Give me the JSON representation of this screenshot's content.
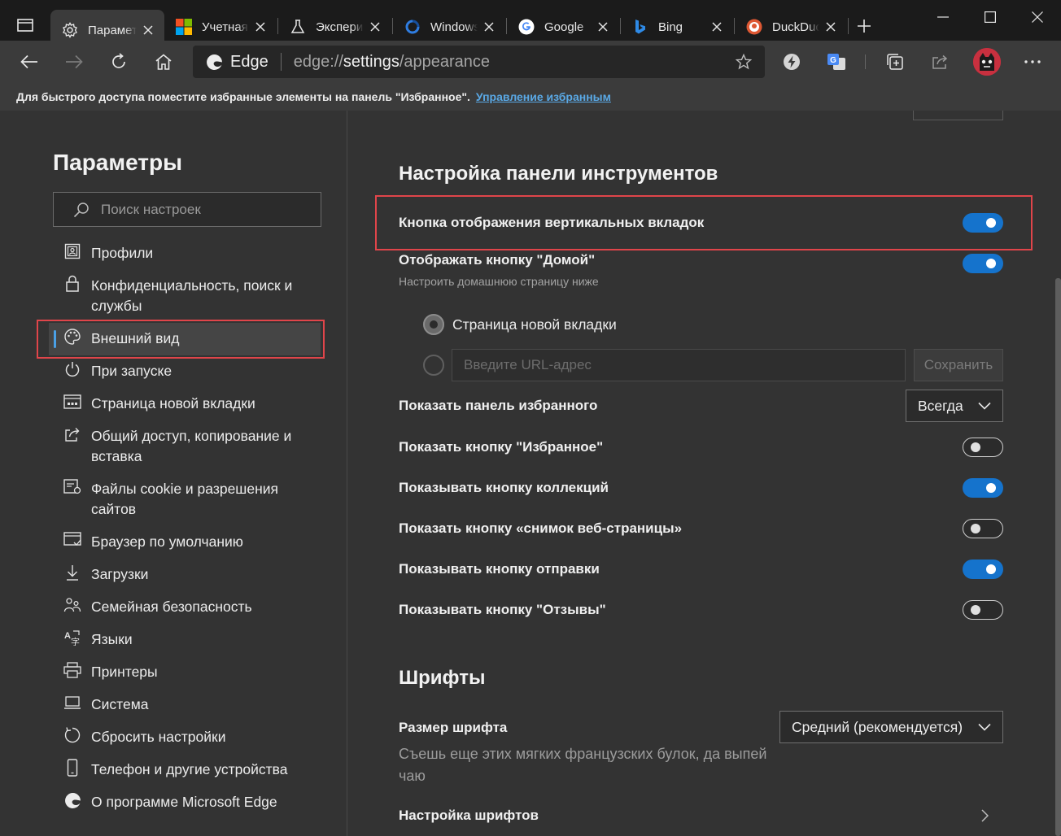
{
  "tabs": [
    {
      "title": "Параметры",
      "icon": "gear-icon",
      "active": true
    },
    {
      "title": "Учетная запись",
      "icon": "microsoft-logo-icon",
      "active": false
    },
    {
      "title": "Эксперименты",
      "icon": "flask-icon",
      "active": false
    },
    {
      "title": "Windows",
      "icon": "windows-site-icon",
      "active": false
    },
    {
      "title": "Google",
      "icon": "google-icon",
      "active": false
    },
    {
      "title": "Bing",
      "icon": "bing-icon",
      "active": false
    },
    {
      "title": "DuckDuckGo",
      "icon": "duckduckgo-icon",
      "active": false
    }
  ],
  "address_bar": {
    "identity_label": "Edge",
    "url_prefix": "edge://",
    "url_host": "settings",
    "url_path": "/appearance"
  },
  "favorites_bar": {
    "message": "Для быстрого доступа поместите избранные элементы на панель \"Избранное\".",
    "link": "Управление избранным"
  },
  "sidebar": {
    "title": "Параметры",
    "search_placeholder": "Поиск настроек",
    "items": [
      {
        "label": "Профили",
        "icon": "profile-icon"
      },
      {
        "label": "Конфиденциальность, поиск и службы",
        "icon": "lock-icon"
      },
      {
        "label": "Внешний вид",
        "icon": "palette-icon",
        "selected": true
      },
      {
        "label": "При запуске",
        "icon": "power-icon"
      },
      {
        "label": "Страница новой вкладки",
        "icon": "new-tab-page-icon"
      },
      {
        "label": "Общий доступ, копирование и вставка",
        "icon": "share-icon"
      },
      {
        "label": "Файлы cookie и разрешения сайтов",
        "icon": "cookies-icon"
      },
      {
        "label": "Браузер по умолчанию",
        "icon": "default-browser-icon"
      },
      {
        "label": "Загрузки",
        "icon": "download-icon"
      },
      {
        "label": "Семейная безопасность",
        "icon": "family-icon"
      },
      {
        "label": "Языки",
        "icon": "languages-icon"
      },
      {
        "label": "Принтеры",
        "icon": "printer-icon"
      },
      {
        "label": "Система",
        "icon": "laptop-icon"
      },
      {
        "label": "Сбросить настройки",
        "icon": "reset-icon"
      },
      {
        "label": "Телефон и другие устройства",
        "icon": "phone-icon"
      },
      {
        "label": "О программе Microsoft Edge",
        "icon": "edge-logo-icon"
      }
    ]
  },
  "toolbar_section": {
    "title": "Настройка панели инструментов",
    "vertical_tabs": {
      "label": "Кнопка отображения вертикальных вкладок",
      "on": true
    },
    "home_button": {
      "label": "Отображать кнопку \"Домой\"",
      "sub": "Настроить домашнюю страницу ниже",
      "on": true
    },
    "home_options": {
      "new_tab": "Страница новой вкладки",
      "url_placeholder": "Введите URL-адрес",
      "save": "Сохранить"
    },
    "favorites_bar_row": {
      "label": "Показать панель избранного",
      "value": "Всегда"
    },
    "favorites_button": {
      "label": "Показать кнопку \"Избранное\"",
      "on": false
    },
    "collections_button": {
      "label": "Показывать кнопку коллекций",
      "on": true
    },
    "web_capture_button": {
      "label": "Показать кнопку «снимок веб-страницы»",
      "on": false
    },
    "share_button": {
      "label": "Показывать кнопку отправки",
      "on": true
    },
    "feedback_button": {
      "label": "Показывать кнопку \"Отзывы\"",
      "on": false
    }
  },
  "fonts_section": {
    "title": "Шрифты",
    "size_label": "Размер шрифта",
    "size_value": "Средний (рекомендуется)",
    "sample": "Съешь еще этих мягких французских булок, да выпей чаю",
    "customize": "Настройка шрифтов"
  },
  "colors": {
    "accent": "#1573cc",
    "highlight_box": "#e0454a"
  }
}
